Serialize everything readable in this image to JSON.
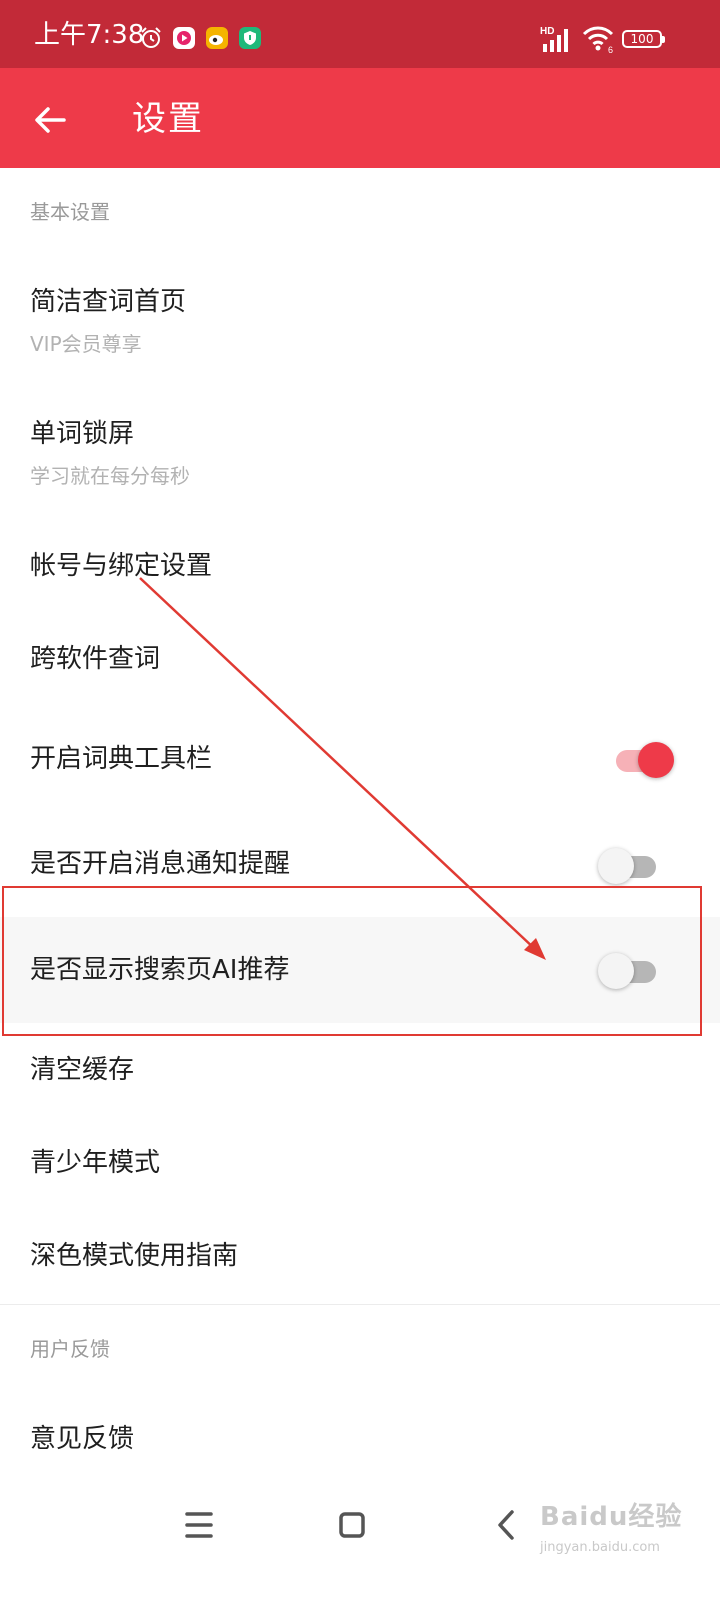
{
  "status_bar": {
    "time": "上午7:38",
    "network": "HD",
    "wifi_badge": "6",
    "battery": "100",
    "icons": [
      "alarm-icon",
      "video-app-icon",
      "weibo-icon",
      "shield-app-icon",
      "signal-icon",
      "wifi-icon",
      "battery-icon"
    ]
  },
  "app_bar": {
    "title": "设置",
    "back_icon": "arrow-left-icon",
    "color": "#ee3a49"
  },
  "sections": {
    "basic": "基本设置",
    "feedback": "用户反馈"
  },
  "items": {
    "simple_home": {
      "title": "简洁查词首页",
      "subtitle": "VIP会员尊享"
    },
    "lock_screen": {
      "title": "单词锁屏",
      "subtitle": "学习就在每分每秒"
    },
    "account": {
      "title": "帐号与绑定设置"
    },
    "cross_app": {
      "title": "跨软件查词"
    },
    "toolbar": {
      "title": "开启词典工具栏",
      "toggle_on": true
    },
    "notification": {
      "title": "是否开启消息通知提醒",
      "toggle_on": false
    },
    "ai_recommend": {
      "title": "是否显示搜索页AI推荐",
      "toggle_on": false
    },
    "clear_cache": {
      "title": "清空缓存"
    },
    "youth_mode": {
      "title": "青少年模式"
    },
    "dark_mode": {
      "title": "深色模式使用指南"
    },
    "feedback": {
      "title": "意见反馈"
    }
  },
  "nav_bar": {
    "icons": [
      "menu-icon",
      "home-icon",
      "back-icon"
    ]
  },
  "watermark": {
    "brand": "Baidu经验",
    "url": "jingyan.baidu.com"
  },
  "colors": {
    "accent": "#ee3a49",
    "status_bar": "#c22a38",
    "annotation": "#e03a33"
  }
}
